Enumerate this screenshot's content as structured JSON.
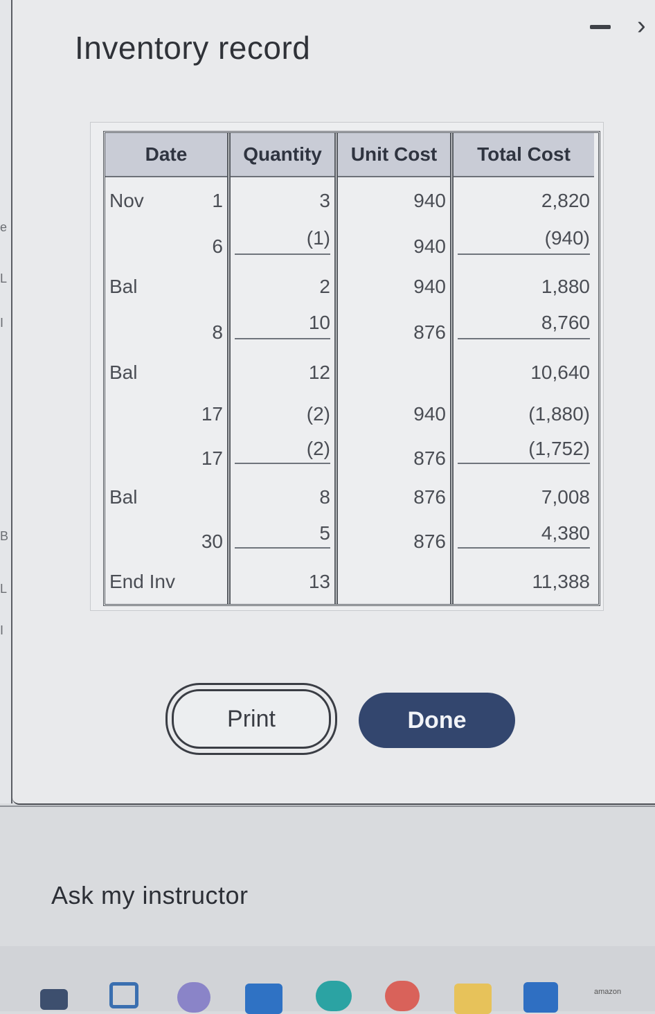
{
  "dialog": {
    "title": "Inventory record",
    "minimize_symbol": "−",
    "next_symbol": "›"
  },
  "table": {
    "headers": [
      "Date",
      "Quantity",
      "Unit Cost",
      "Total Cost"
    ],
    "rows": [
      {
        "label": "Nov",
        "day": "1",
        "quantity": "3",
        "unit_cost": "940",
        "total_cost": "2,820"
      },
      {
        "label": "",
        "day": "6",
        "quantity": "(1)",
        "unit_cost": "940",
        "total_cost": "(940)"
      },
      {
        "label": "Bal",
        "day": "",
        "quantity": "2",
        "unit_cost": "940",
        "total_cost": "1,880"
      },
      {
        "label": "",
        "day": "8",
        "quantity": "10",
        "unit_cost": "876",
        "total_cost": "8,760"
      },
      {
        "label": "Bal",
        "day": "",
        "quantity": "12",
        "unit_cost": "",
        "total_cost": "10,640"
      },
      {
        "label": "",
        "day": "17",
        "quantity": "(2)",
        "unit_cost": "940",
        "total_cost": "(1,880)"
      },
      {
        "label": "",
        "day": "17",
        "quantity": "(2)",
        "unit_cost": "876",
        "total_cost": "(1,752)"
      },
      {
        "label": "Bal",
        "day": "",
        "quantity": "8",
        "unit_cost": "876",
        "total_cost": "7,008"
      },
      {
        "label": "",
        "day": "30",
        "quantity": "5",
        "unit_cost": "876",
        "total_cost": "4,380"
      },
      {
        "label": "End Inv",
        "day": "",
        "quantity": "13",
        "unit_cost": "",
        "total_cost": "11,388"
      }
    ]
  },
  "buttons": {
    "print": "Print",
    "done": "Done"
  },
  "footer": {
    "ask_instructor": "Ask my instructor"
  },
  "left_strip": [
    "e",
    "L",
    "I",
    "B",
    "L",
    "I"
  ],
  "taskbar": {
    "icons": [
      "file-explorer-icon",
      "widgets-icon",
      "teams-icon",
      "mail-icon",
      "edge-icon",
      "chrome-icon",
      "folder-icon",
      "store-icon",
      "amazon-icon"
    ],
    "amazon_label": "amazon"
  },
  "colors": {
    "header_bg": "#c9ccd6",
    "done_button": "#33466e",
    "dialog_bg": "#e9eaec"
  }
}
